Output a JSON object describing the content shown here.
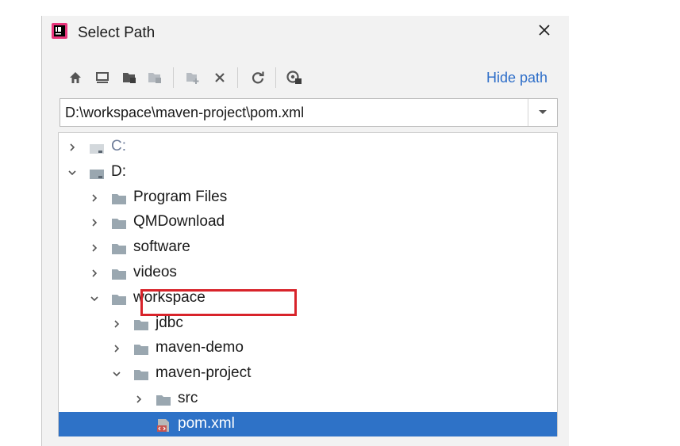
{
  "window": {
    "title": "Select Path",
    "close_icon": "close-icon"
  },
  "toolbar": {
    "buttons": [
      {
        "name": "home-button",
        "icon": "home-icon"
      },
      {
        "name": "desktop-button",
        "icon": "desktop-icon"
      },
      {
        "name": "project-button",
        "icon": "project-folder-icon"
      },
      {
        "name": "module-button",
        "icon": "module-folder-icon"
      },
      {
        "name": "new-folder-button",
        "icon": "new-folder-icon"
      },
      {
        "name": "delete-button",
        "icon": "delete-icon"
      },
      {
        "name": "refresh-button",
        "icon": "refresh-icon"
      },
      {
        "name": "show-hidden-button",
        "icon": "show-hidden-icon"
      }
    ],
    "hide_path_label": "Hide path"
  },
  "path": {
    "value": "D:\\workspace\\maven-project\\pom.xml"
  },
  "tree": {
    "items": [
      {
        "label": "C:",
        "depth": 0,
        "expanded": false,
        "kind": "drive",
        "muted": true
      },
      {
        "label": "D:",
        "depth": 0,
        "expanded": true,
        "kind": "drive"
      },
      {
        "label": "Program Files",
        "depth": 1,
        "expanded": false,
        "kind": "folder"
      },
      {
        "label": "QMDownload",
        "depth": 1,
        "expanded": false,
        "kind": "folder"
      },
      {
        "label": "software",
        "depth": 1,
        "expanded": false,
        "kind": "folder"
      },
      {
        "label": "videos",
        "depth": 1,
        "expanded": false,
        "kind": "folder"
      },
      {
        "label": "workspace",
        "depth": 1,
        "expanded": true,
        "kind": "folder"
      },
      {
        "label": "jdbc",
        "depth": 2,
        "expanded": false,
        "kind": "folder"
      },
      {
        "label": "maven-demo",
        "depth": 2,
        "expanded": false,
        "kind": "folder"
      },
      {
        "label": "maven-project",
        "depth": 2,
        "expanded": true,
        "kind": "folder"
      },
      {
        "label": "src",
        "depth": 3,
        "expanded": false,
        "kind": "folder"
      },
      {
        "label": "pom.xml",
        "depth": 3,
        "kind": "file",
        "selected": true
      }
    ]
  },
  "colors": {
    "accent": "#2e72c7",
    "link": "#2f6fc9",
    "highlight": "#d8232a",
    "folder": "#9aa7b0"
  }
}
